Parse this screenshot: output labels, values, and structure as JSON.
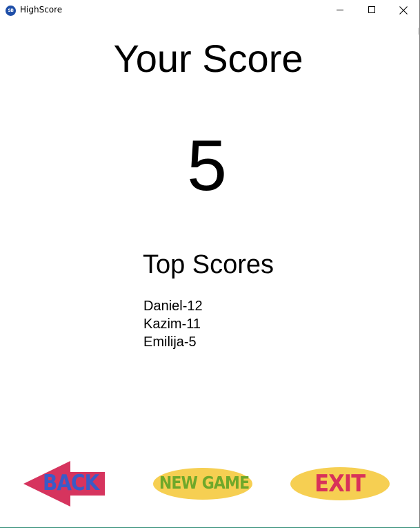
{
  "window": {
    "title": "HighScore",
    "icon_text": "SB",
    "icon": "app-logo-icon",
    "controls": {
      "minimize_icon": "minimize-icon",
      "maximize_icon": "maximize-icon",
      "close_icon": "close-icon"
    }
  },
  "main": {
    "heading": "Your Score",
    "score": "5",
    "top_heading": "Top Scores",
    "top_scores": [
      "Daniel-12",
      "Kazim-11",
      "Emilija-5"
    ]
  },
  "buttons": {
    "back": {
      "label": "BACK",
      "icon": "back-arrow-icon"
    },
    "new_game": {
      "label": "NEW GAME"
    },
    "exit": {
      "label": "EXIT"
    }
  },
  "colors": {
    "back_arrow": "#d6345e",
    "back_text": "#3a5bc7",
    "button_fill": "#f6cf52",
    "new_game_text": "#6fa82a",
    "exit_text": "#d8315a",
    "icon_blue": "#1f4fa8"
  }
}
